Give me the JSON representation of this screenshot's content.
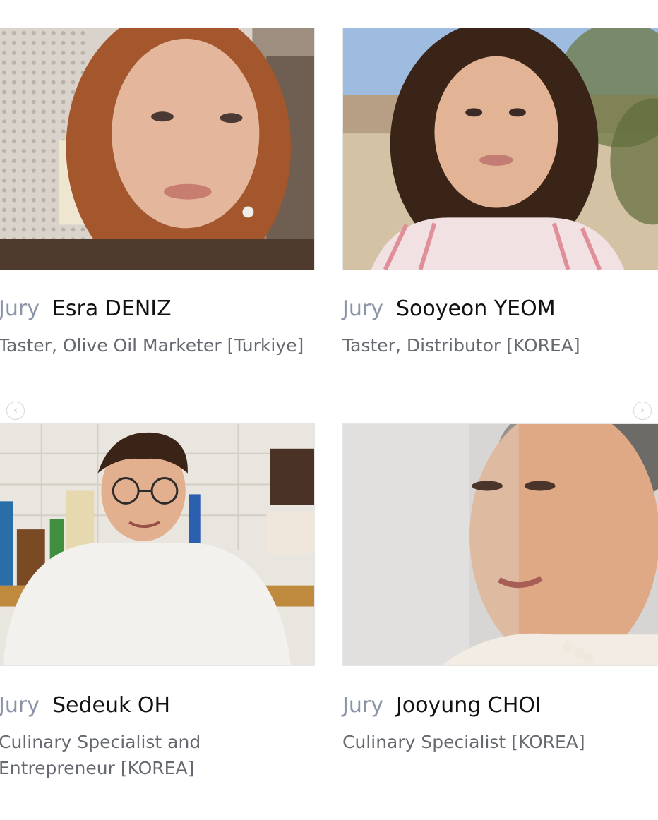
{
  "jury_grid": {
    "members": [
      {
        "role": "Jury",
        "name": "Esra DENIZ",
        "description": "Taster, Olive Oil Marketer [Turkiye]"
      },
      {
        "role": "Jury",
        "name": "Sooyeon YEOM",
        "description": "Taster, Distributor [KOREA]"
      },
      {
        "role": "Jury",
        "name": "Sedeuk OH",
        "description": "Culinary Specialist and Entrepreneur [KOREA]"
      },
      {
        "role": "Jury",
        "name": "Jooyung CHOI",
        "description": "Culinary Specialist [KOREA]"
      }
    ]
  },
  "carousel": {
    "prev_icon": "chevron-left-icon",
    "next_icon": "chevron-right-icon",
    "prev_glyph": "‹",
    "next_glyph": "›"
  },
  "colors": {
    "role_label": "#8a94a6",
    "name": "#111111",
    "description": "#666a70",
    "arrow_border": "#d8d8d8"
  }
}
